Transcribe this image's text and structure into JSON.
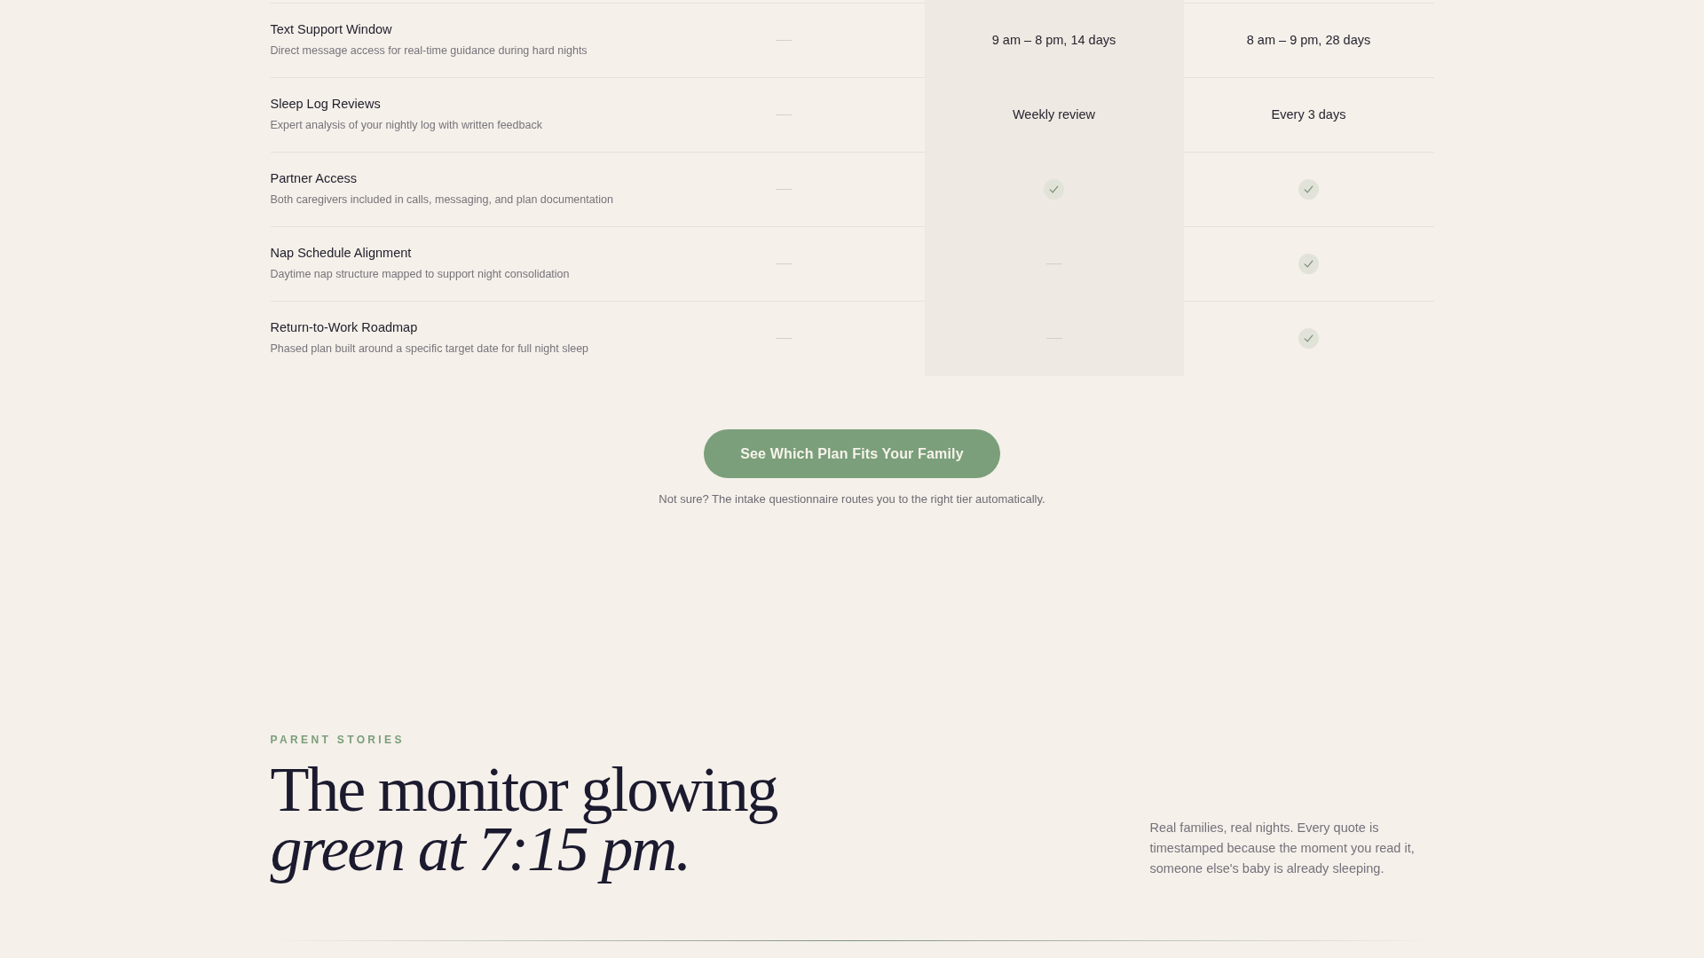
{
  "comparison": {
    "plan_columns": [
      {
        "highlighted": false
      },
      {
        "highlighted": true
      },
      {
        "highlighted": false
      }
    ],
    "rows": [
      {
        "title": "Text Support Window",
        "description": "Direct message access for real-time guidance during hard nights",
        "cells": [
          {
            "kind": "none"
          },
          {
            "kind": "text",
            "text": "9 am – 8 pm, 14 days"
          },
          {
            "kind": "text",
            "text": "8 am – 9 pm, 28 days"
          }
        ]
      },
      {
        "title": "Sleep Log Reviews",
        "description": "Expert analysis of your nightly log with written feedback",
        "cells": [
          {
            "kind": "none"
          },
          {
            "kind": "text",
            "text": "Weekly review"
          },
          {
            "kind": "text",
            "text": "Every 3 days"
          }
        ]
      },
      {
        "title": "Partner Access",
        "description": "Both caregivers included in calls, messaging, and plan documentation",
        "cells": [
          {
            "kind": "none"
          },
          {
            "kind": "included"
          },
          {
            "kind": "included"
          }
        ]
      },
      {
        "title": "Nap Schedule Alignment",
        "description": "Daytime nap structure mapped to support night consolidation",
        "cells": [
          {
            "kind": "none"
          },
          {
            "kind": "none"
          },
          {
            "kind": "included"
          }
        ]
      },
      {
        "title": "Return-to-Work Roadmap",
        "description": "Phased plan built around a specific target date for full night sleep",
        "cells": [
          {
            "kind": "none"
          },
          {
            "kind": "none"
          },
          {
            "kind": "included"
          }
        ]
      }
    ]
  },
  "cta": {
    "button": "See Which Plan Fits Your Family",
    "note": "Not sure? The intake questionnaire routes you to the right tier automatically."
  },
  "stories": {
    "eyebrow": "PARENT STORIES",
    "heading": "The monitor glowing *green at 7:15 pm.*",
    "intro": "Real families, real nights. Every quote is timestamped because the moment you read it, someone else's baby is already sleeping."
  }
}
